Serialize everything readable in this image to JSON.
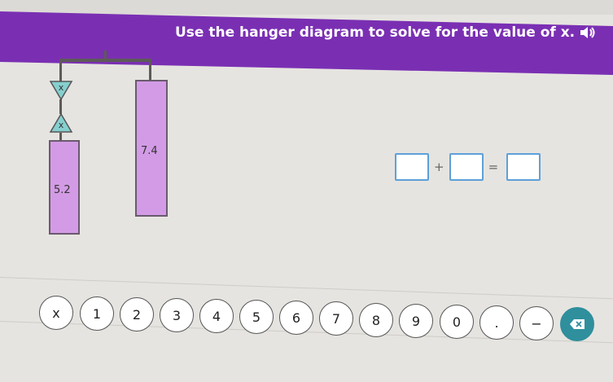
{
  "prompt": {
    "text": "Use the hanger diagram to solve for the value of x.",
    "audio_icon": "speaker-icon"
  },
  "hanger": {
    "variable_label": "x",
    "left_block_value": "5.2",
    "right_block_value": "7.4"
  },
  "equation": {
    "operator": "+",
    "equals": "="
  },
  "keypad": {
    "keys": [
      "x",
      "1",
      "2",
      "3",
      "4",
      "5",
      "6",
      "7",
      "8",
      "9",
      "0",
      ".",
      "−"
    ],
    "delete_icon": "backspace-icon"
  },
  "colors": {
    "banner": "#7a2fb3",
    "block_fill": "#d39be6",
    "variable_fill": "#86cfcf",
    "answer_border": "#5ea0d8",
    "delete_key": "#2f8f9d"
  }
}
